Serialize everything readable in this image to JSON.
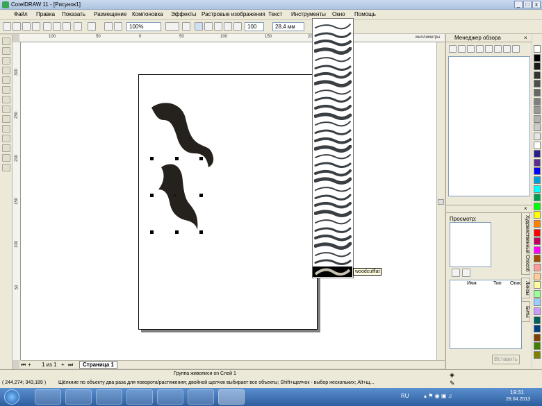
{
  "title": "CorelDRAW 11 - [Рисунок1]",
  "window_buttons": [
    "_",
    "□",
    "x"
  ],
  "menu": [
    "Файл",
    "Правка",
    "Показать",
    "Размещение",
    "Компоновка",
    "Эффекты",
    "Растровые изображения",
    "Текст",
    "Инструменты",
    "Окно",
    "Помощь"
  ],
  "toolbar": {
    "zoom": "100%",
    "angle": "100",
    "stroke_width": "28,4 мм"
  },
  "ruler": {
    "unit": "миллиметры",
    "h_ticks": [
      "100",
      "50",
      "0",
      "50",
      "100",
      "150",
      "200"
    ],
    "v_ticks": [
      "300",
      "250",
      "200",
      "150",
      "100",
      "50"
    ]
  },
  "stroke_dropdown": {
    "tooltip": "woodcutflat",
    "item_count": 31
  },
  "page_nav": {
    "counter": "1 из 1",
    "tab": "Страница 1"
  },
  "docker": {
    "title": "Менеджер обзора",
    "preview_label": "Просмотр:",
    "columns": [
      "Имя",
      "Тип",
      "Опис"
    ],
    "insert_button": "Вставить",
    "side_tabs": [
      "Художественный Способ",
      "Линзы",
      "Биты"
    ]
  },
  "status": {
    "object_info": "Группа живописи on Слой 1",
    "coords": "( 244,274; 343,189 )",
    "hint": "Щёлкние по объекту два раза для поворота/растяжения; двойной щелчок выбирает все объекты; Shift+щелчок - выбор нескольких; Alt+щ..."
  },
  "taskbar": {
    "lang": "RU",
    "time": "19:31",
    "date": "28.04.2013"
  },
  "palette_colors": [
    "#ffffff",
    "#000000",
    "#1a1a1a",
    "#333333",
    "#4d4d4d",
    "#666666",
    "#808080",
    "#999999",
    "#b3b3b3",
    "#cccccc",
    "#e6e6e6",
    "#ffffff",
    "#2b1e8c",
    "#5b2d8e",
    "#0000ff",
    "#00a0e0",
    "#00ffff",
    "#00a050",
    "#00ff00",
    "#ffff00",
    "#ff8000",
    "#ff0000",
    "#c00060",
    "#ff00ff",
    "#a05000",
    "#ff9999",
    "#ffcc99",
    "#ffff99",
    "#99ff99",
    "#99ccff",
    "#cc99ff",
    "#006060",
    "#004080",
    "#804000",
    "#408000",
    "#808000"
  ],
  "accent": "#2e5e9e"
}
